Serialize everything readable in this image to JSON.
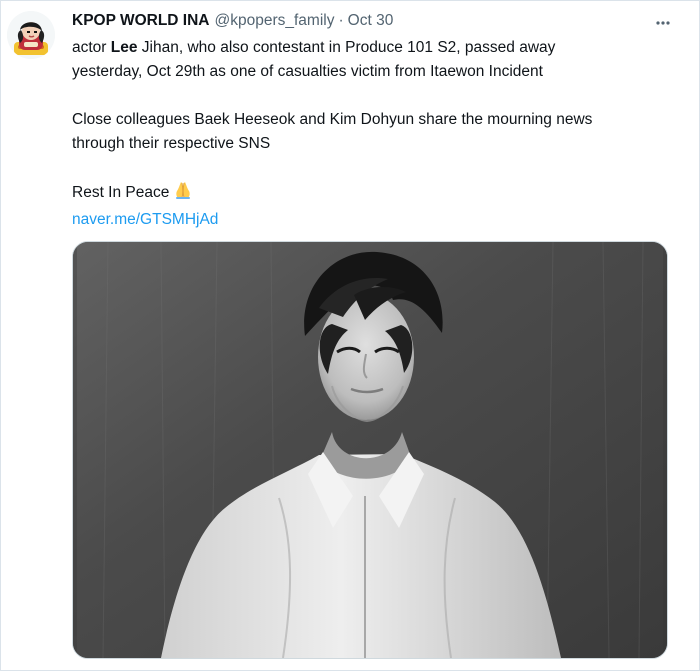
{
  "tweet": {
    "author_name": "KPOP WORLD INA",
    "author_handle": "@kpopers_family",
    "separator": "·",
    "timestamp": "Oct 30",
    "text": {
      "line1_prefix": "actor ",
      "line1_bold": "Lee",
      "line1_suffix": " Jihan, who also contestant in Produce 101 S2, passed away",
      "line2": "yesterday, Oct 29th as one of casualties victim from Itaewon Incident",
      "line3": "Close colleagues Baek Heeseok and Kim Dohyun share the mourning news",
      "line4": "through their respective SNS",
      "line5": "Rest In Peace"
    },
    "link": "naver.me/GTSMHjAd",
    "icons": {
      "avatar": "avatar-icon",
      "more": "more-options-icon",
      "emoji": "folded-hands-icon"
    }
  },
  "colors": {
    "text": "#0f1419",
    "secondary": "#536471",
    "link": "#1d9bf0",
    "border": "#cfd9de"
  }
}
